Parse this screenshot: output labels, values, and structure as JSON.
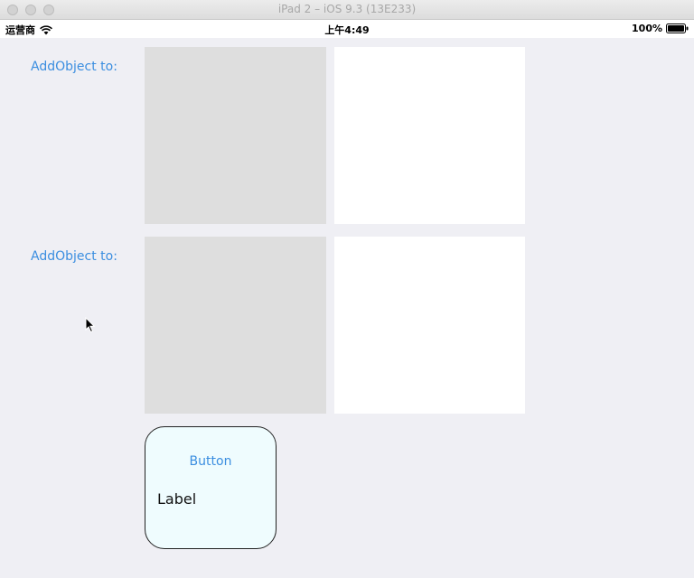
{
  "window": {
    "title": "iPad 2 – iOS 9.3 (13E233)"
  },
  "status_bar": {
    "carrier": "运营商",
    "time": "上午4:49",
    "battery": "100%"
  },
  "rows": [
    {
      "label": "AddObject to:"
    },
    {
      "label": "AddObject to:"
    }
  ],
  "card": {
    "button_label": "Button",
    "label": "Label"
  },
  "icons": {
    "wifi": "wifi-icon",
    "battery": "battery-icon",
    "cursor": "mouse-cursor-icon"
  }
}
